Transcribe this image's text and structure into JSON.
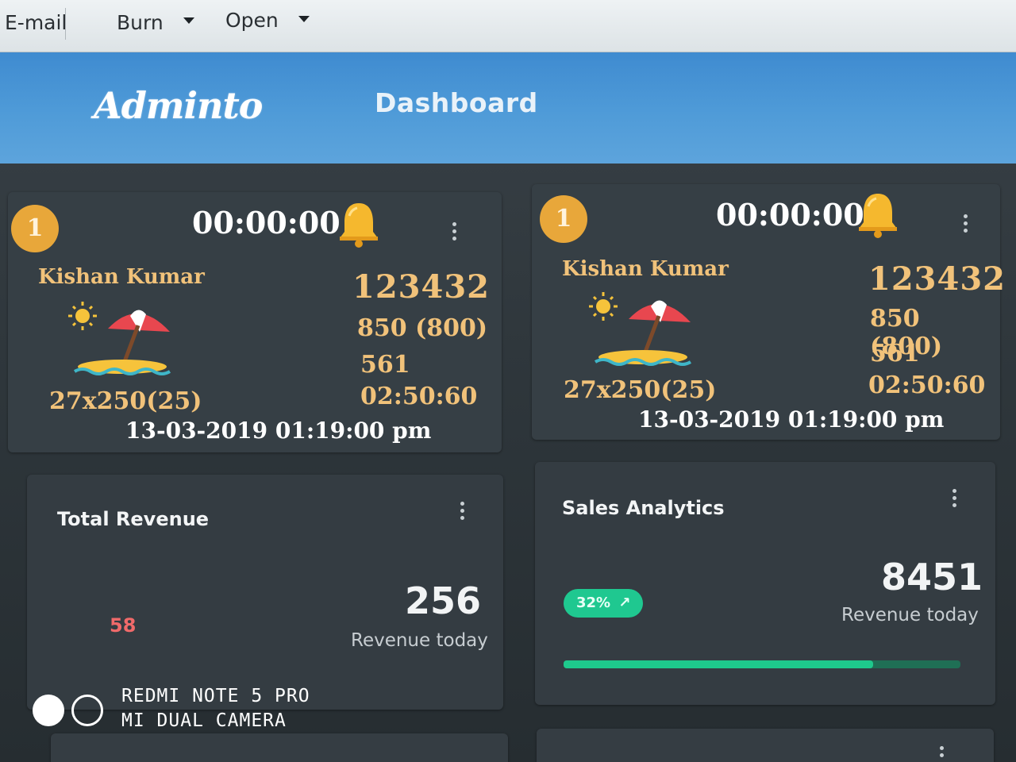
{
  "toolbar": {
    "email_label": "E-mail",
    "burn_label": "Burn",
    "open_label": "Open"
  },
  "header": {
    "logo": "Adminto",
    "nav_title": "Dashboard",
    "accent_color": "#4f9bd8"
  },
  "ticket_cards": [
    {
      "badge": "1",
      "timer": "00:00:00",
      "name": "Kishan Kumar",
      "code": "123432",
      "amount": "850 (800)",
      "count": "561",
      "duration": "02:50:60",
      "size": "27x250(25)",
      "datetime": "13-03-2019 01:19:00 pm",
      "icons": [
        "bell-icon",
        "beach-icon"
      ]
    },
    {
      "badge": "1",
      "timer": "00:00:00",
      "name": "Kishan Kumar",
      "code": "123432",
      "amount": "850 (800)",
      "count": "561",
      "duration": "02:50:60",
      "size": "27x250(25)",
      "datetime": "13-03-2019 01:19:00 pm",
      "icons": [
        "bell-icon",
        "beach-icon"
      ]
    }
  ],
  "total_revenue": {
    "title": "Total Revenue",
    "value": "256",
    "label": "Revenue today",
    "secondary_value": "58"
  },
  "sales_analytics": {
    "title": "Sales Analytics",
    "value": "8451",
    "label": "Revenue today",
    "change_pill": "32%",
    "progress": 0.78
  },
  "watermark": {
    "line1": "REDMI NOTE 5 PRO",
    "line2": "MI DUAL CAMERA"
  }
}
